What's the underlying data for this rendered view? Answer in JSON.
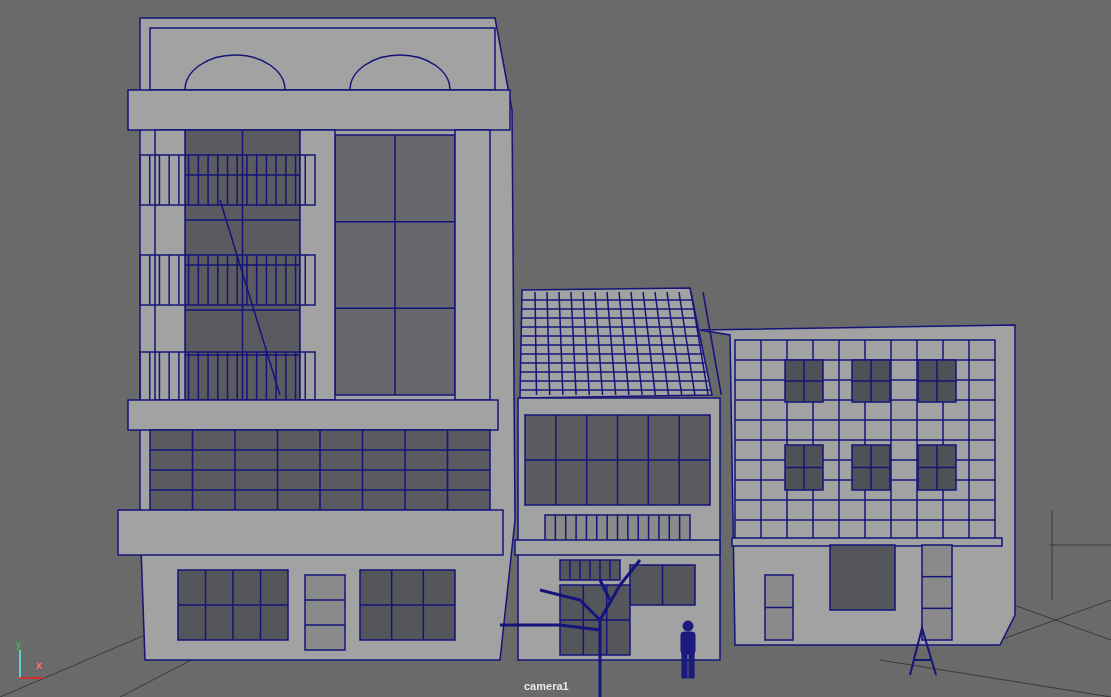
{
  "viewport": {
    "camera_label": "camera1",
    "axis_gizmo": {
      "y_label": "y",
      "x_label": "x"
    }
  }
}
